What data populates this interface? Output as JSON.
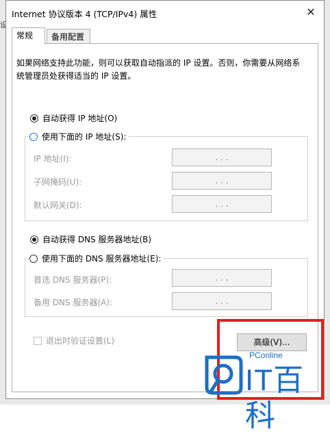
{
  "background": {
    "left_fragment": "设"
  },
  "window": {
    "title": "Internet 协议版本 4 (TCP/IPv4) 属性",
    "close_glyph": "✕"
  },
  "tabs": [
    {
      "label": "常规",
      "active": true
    },
    {
      "label": "备用配置",
      "active": false
    }
  ],
  "description": "如果网络支持此功能，则可以获取自动指派的 IP 设置。否则，你需要从网络系统管理员处获得适当的 IP 设置。",
  "ip_section": {
    "auto_option": "自动获得 IP 地址(O)",
    "auto_selected": true,
    "manual_option": "使用下面的 IP 地址(S):",
    "fields": [
      {
        "label": "IP 地址(I):",
        "value": ".  .  ."
      },
      {
        "label": "子网掩码(U):",
        "value": ".  .  ."
      },
      {
        "label": "默认网关(D):",
        "value": ".  .  ."
      }
    ]
  },
  "dns_section": {
    "auto_option": "自动获得 DNS 服务器地址(B)",
    "auto_selected": true,
    "manual_option": "使用下面的 DNS 服务器地址(E):",
    "fields": [
      {
        "label": "首选 DNS 服务器(P):",
        "value": ".  .  ."
      },
      {
        "label": "备用 DNS 服务器(A):",
        "value": ".  .  ."
      }
    ]
  },
  "validate_checkbox": {
    "label": "退出时验证设置(L)",
    "checked": false
  },
  "advanced_button": {
    "label": "高级(V)..."
  },
  "watermark": {
    "brand_sub": "PConline",
    "brand_main": "IT百科"
  },
  "colors": {
    "highlight_red": "#e02020",
    "watermark_blue": "#1b6fc7"
  }
}
